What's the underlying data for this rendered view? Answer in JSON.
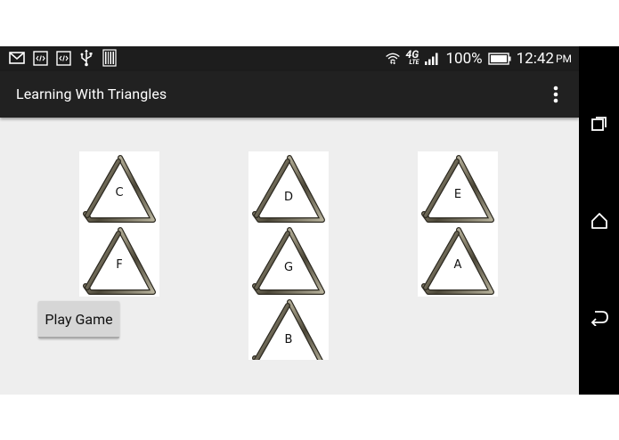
{
  "status_bar": {
    "notification_icons": [
      "gmail-icon",
      "code-icon",
      "code-icon",
      "usb-icon",
      "barcode-icon"
    ],
    "network": "4G",
    "network_sub": "LTE",
    "battery_percent": "100%",
    "time": "12:42",
    "ampm": "PM"
  },
  "action_bar": {
    "title": "Learning With Triangles",
    "overflow_icon": "more-vertical-icon"
  },
  "triangles": {
    "col1": {
      "top": "C",
      "bottom": "F"
    },
    "col2": {
      "top": "D",
      "middle": "G",
      "bottom": "B"
    },
    "col3": {
      "top": "E",
      "bottom": "A"
    }
  },
  "play_button": {
    "label": "Play Game"
  },
  "nav_bar": {
    "icons": [
      "recent-apps-icon",
      "home-icon",
      "back-icon"
    ]
  },
  "colors": {
    "status_bar": "#1d1d1d",
    "action_bar": "#212121",
    "content_bg": "#eeeeee",
    "button_bg": "#d6d6d6",
    "nav_bar": "#000000"
  }
}
